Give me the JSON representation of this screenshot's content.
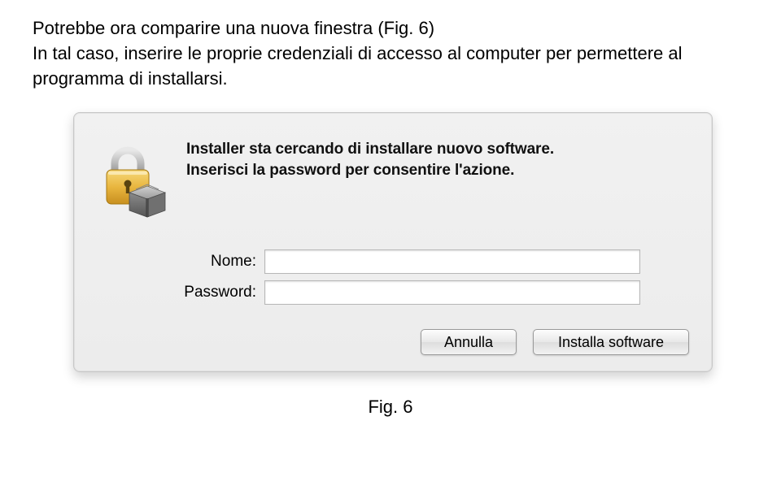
{
  "doc": {
    "paragraph1": "Potrebbe ora comparire una nuova finestra (Fig. 6)",
    "paragraph2": "In tal caso, inserire le proprie credenziali di accesso al computer per permettere al programma di installarsi."
  },
  "dialog": {
    "message_line1": "Installer sta cercando di installare nuovo software.",
    "message_line2": "Inserisci la password per consentire l'azione.",
    "fields": {
      "name_label": "Nome:",
      "name_value": "",
      "password_label": "Password:",
      "password_value": ""
    },
    "buttons": {
      "cancel": "Annulla",
      "install": "Installa software"
    }
  },
  "caption": "Fig. 6"
}
